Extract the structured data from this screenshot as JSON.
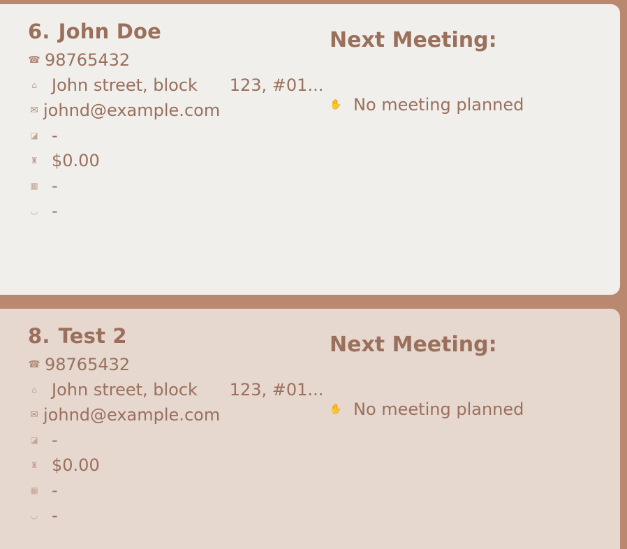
{
  "section_labels": {
    "next_meeting": "Next Meeting:",
    "no_meeting": "No meeting planned"
  },
  "icons": {
    "phone": "☎",
    "address": "⌂",
    "email": "✉",
    "note": "◪",
    "money": "♜",
    "bank": "▦",
    "handshake": "◡",
    "meeting": "✋"
  },
  "persons": [
    {
      "index": "6.",
      "name": "John Doe",
      "phone": "98765432",
      "address": "John street, block      123, #01...",
      "email": "johnd@example.com",
      "note": "-",
      "money": "$0.00",
      "bank": "-",
      "deal": "-"
    },
    {
      "index": "8.",
      "name": "Test 2",
      "phone": "98765432",
      "address": "John street, block      123, #01...",
      "email": "johnd@example.com",
      "note": "-",
      "money": "$0.00",
      "bank": "-",
      "deal": "-"
    }
  ]
}
